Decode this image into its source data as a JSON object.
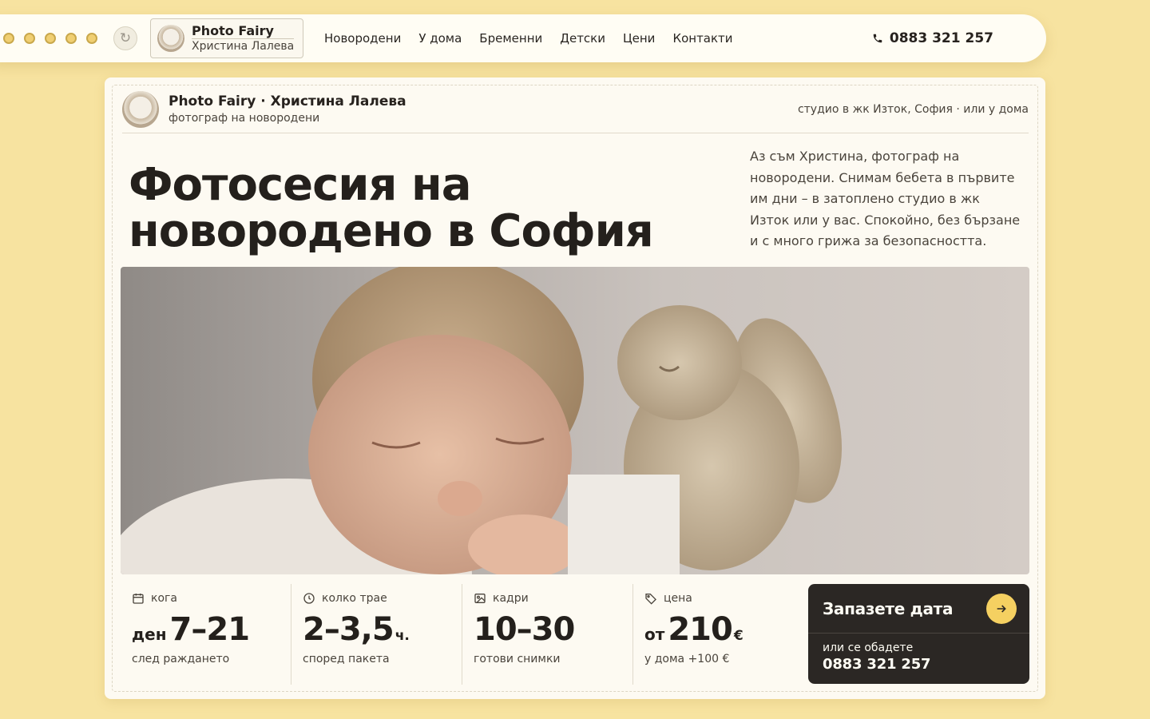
{
  "browser": {
    "brand_name": "Photo Fairy",
    "brand_owner": "Христина Лалева",
    "nav": [
      "Новородени",
      "У дома",
      "Бременни",
      "Детски",
      "Цени",
      "Контакти"
    ],
    "phone": "0883 321 257"
  },
  "header": {
    "title": "Photo Fairy · Христина Лалева",
    "subtitle": "фотограф на новородени",
    "location": "студио в жк Изток, София · или у дома"
  },
  "hero": {
    "title": "Фотосесия на новородено в София",
    "intro": "Аз съм Христина, фотограф на новородени. Снимам бебета в първите им дни – в затоплено студио в жк Изток или у вас. Спокойно, без бързане и с много грижа за безопасността."
  },
  "stats": [
    {
      "label": "кога",
      "pre": "ден",
      "value": "7–21",
      "suffix": "",
      "note": "след раждането",
      "icon": "calendar-icon"
    },
    {
      "label": "колко трае",
      "pre": "",
      "value": "2–3,5",
      "suffix": "ч.",
      "note": "според пакета",
      "icon": "clock-icon"
    },
    {
      "label": "кадри",
      "pre": "",
      "value": "10–30",
      "suffix": "",
      "note": "готови снимки",
      "icon": "image-icon"
    },
    {
      "label": "цена",
      "pre": "от",
      "value": "210",
      "suffix": "€",
      "note": "у дома +100 €",
      "icon": "tag-icon"
    }
  ],
  "cta": {
    "title": "Запазете дата",
    "or_call": "или се обадете",
    "phone": "0883 321 257"
  },
  "colors": {
    "page_bg": "#f7e3a0",
    "card_bg": "#fdfaf2",
    "dark": "#2b2724",
    "accent": "#f5d061"
  }
}
